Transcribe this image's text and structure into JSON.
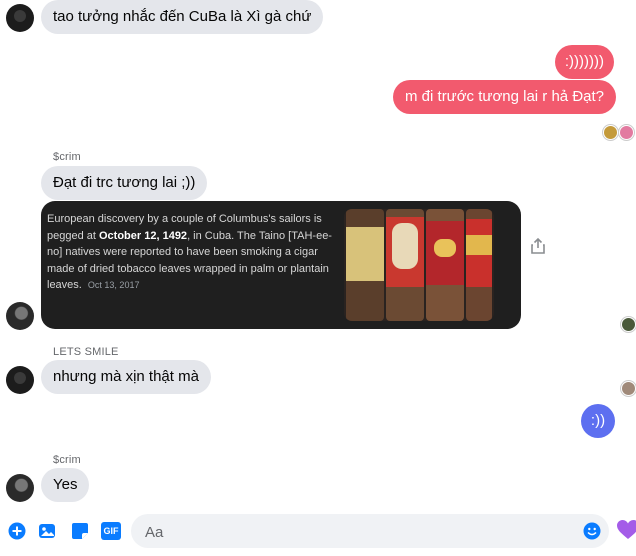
{
  "messages": {
    "m1": "tao tưởng nhắc đến CuBa là Xì gà chứ",
    "m2": ":)))))))",
    "m3": "m đi trước tương lai r hả Đạt?",
    "m4_sender": "$crim",
    "m4": "Đạt đi trc tương lai ;))",
    "m5_sender": "LETS SMILE",
    "m5": "nhưng mà xịn thật mà",
    "m6": ":))",
    "m7_sender": "$crim",
    "m7": "Yes"
  },
  "link_card": {
    "text_before": "European discovery by a couple of Columbus's sailors is pegged at ",
    "bold_date": "October 12, 1492",
    "text_after": ", in Cuba. The Taino [TAH-ee-no] natives were reported to have been smoking a cigar made of dried tobacco leaves wrapped in palm or plantain leaves.",
    "date": "Oct 13, 2017",
    "image_label": "cigars-photo"
  },
  "composer": {
    "placeholder": "Aa"
  },
  "icons": {
    "add": "plus-circle-icon",
    "image": "image-icon",
    "sticker": "sticker-icon",
    "gif": "GIF",
    "emoji": "emoji-icon",
    "react": "heart-icon",
    "share": "share-icon"
  },
  "colors": {
    "outgoing_bubble": "#f25a6e",
    "incoming_bubble": "#e4e6eb",
    "accent_blue": "#5d6ff0",
    "toolbar_blue": "#0a7cff",
    "heart": "#a45ce8"
  }
}
